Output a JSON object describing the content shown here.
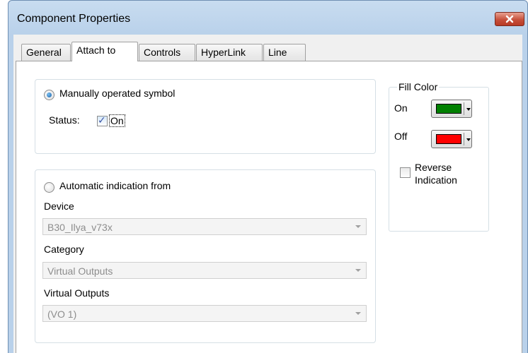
{
  "window": {
    "title": "Component Properties"
  },
  "tabs": [
    {
      "label": "General"
    },
    {
      "label": "Attach to"
    },
    {
      "label": "Controls"
    },
    {
      "label": "HyperLink"
    },
    {
      "label": "Line"
    }
  ],
  "active_tab": "Attach to",
  "manual": {
    "radio_label": "Manually operated symbol",
    "radio_selected": true,
    "status_label": "Status:",
    "status_checkbox_label": "On",
    "status_checked": true
  },
  "automatic": {
    "radio_label": "Automatic indication from",
    "radio_selected": false,
    "device_label": "Device",
    "device_value": "B30_Ilya_v73x",
    "category_label": "Category",
    "category_value": "Virtual Outputs",
    "virtual_outputs_label": "Virtual Outputs",
    "virtual_outputs_value": "(VO  1)"
  },
  "fill_color": {
    "legend": "Fill Color",
    "on_label": "On",
    "on_color": "#008000",
    "off_label": "Off",
    "off_color": "#ff0000",
    "reverse_label_line1": "Reverse",
    "reverse_label_line2": "Indication",
    "reverse_checked": false
  },
  "icons": {
    "close": "close-icon",
    "dropdown": "chevron-down-icon"
  }
}
